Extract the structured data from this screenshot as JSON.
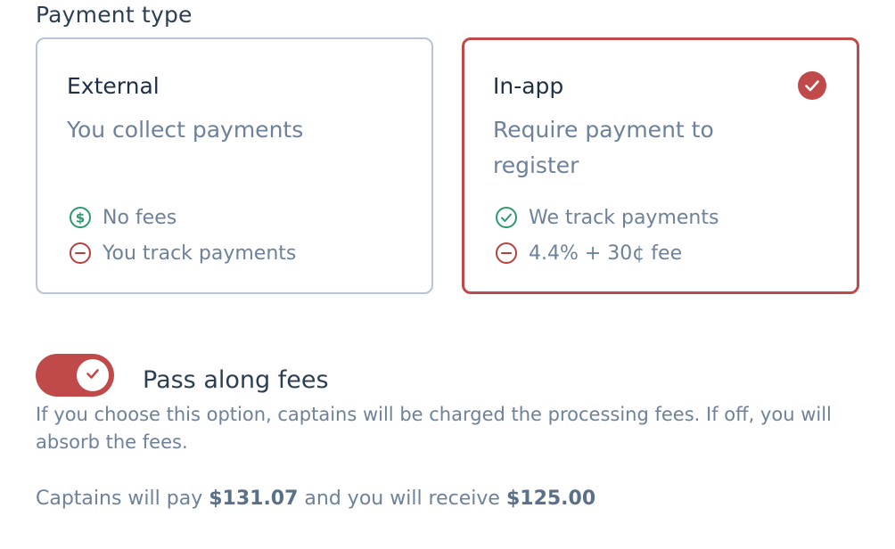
{
  "section_title": "Payment type",
  "options": [
    {
      "title": "External",
      "description": "You collect payments",
      "features": [
        {
          "icon": "dollar-circle-icon",
          "text": "No fees",
          "tone": "positive"
        },
        {
          "icon": "minus-circle-icon",
          "text": "You track payments",
          "tone": "negative"
        }
      ],
      "selected": false
    },
    {
      "title": "In-app",
      "description": "Require payment to register",
      "features": [
        {
          "icon": "check-circle-icon",
          "text": "We track payments",
          "tone": "positive"
        },
        {
          "icon": "minus-circle-icon",
          "text": "4.4% + 30¢ fee",
          "tone": "negative"
        }
      ],
      "selected": true
    }
  ],
  "pass_fees": {
    "label": "Pass along fees",
    "enabled": true,
    "help": "If you choose this option, captains will be charged the processing fees. If off, you will absorb the fees."
  },
  "summary": {
    "prefix": "Captains will pay",
    "captain_pays": "$131.07",
    "middle": "and you will receive",
    "you_receive": "$125.00"
  },
  "colors": {
    "accent": "#c04a4a",
    "positive": "#2e9a6b",
    "negative": "#b5413f",
    "border_default": "#b7c4d3",
    "text_primary": "#1f2f45",
    "text_muted": "#6d829a"
  }
}
